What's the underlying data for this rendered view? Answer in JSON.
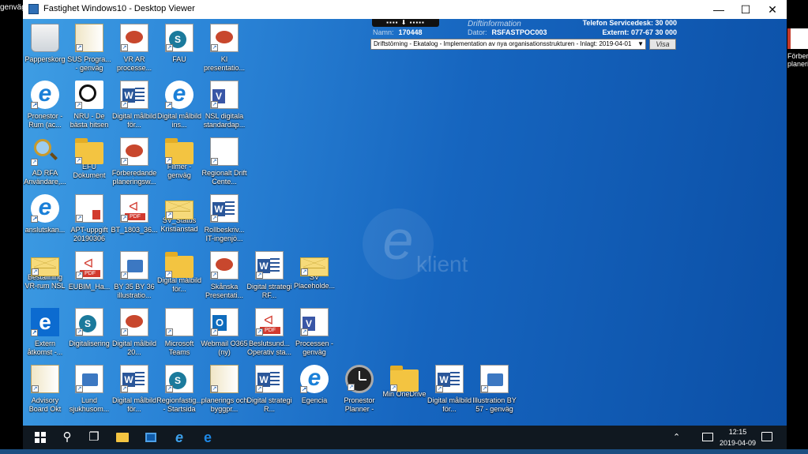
{
  "host": {
    "left_fragment": "genväg",
    "right_icon_label": "Förbereda planerin"
  },
  "window": {
    "title": "Fastighet Windows10 - Desktop Viewer",
    "controls": {
      "minimize": "—",
      "maximize": "☐",
      "close": "✕"
    }
  },
  "driftinfo": {
    "tab_label": "▪▪▪▪ ⬇ ▪▪▪▪▪",
    "title": "Driftinformation",
    "name_label": "Namn:",
    "name_value": "170448",
    "computer_label": "Dator:",
    "computer_value": "RSFASTPOC003",
    "servicedesk": "Telefon Servicedesk: 30 000",
    "external": "Externt: 077-67 30 000",
    "select_value": "Driftstörning - Ekatalog - Implementation av nya organisationsstrukturen - Inlagt: 2019-04-01",
    "button_label": "Visa"
  },
  "watermark": {
    "letter": "e",
    "text": "klient"
  },
  "icons": [
    {
      "label": "Papperskorg"
    },
    {
      "label": "SUS Progra... - genväg"
    },
    {
      "label": "VR AR processe..."
    },
    {
      "label": "FAU"
    },
    {
      "label": "KI presentatio..."
    },
    {
      "label": "Pronestor - Rum (ac..."
    },
    {
      "label": "NRU - De bästa hitsen"
    },
    {
      "label": "Digital målbild för..."
    },
    {
      "label": "Digital målbild ins..."
    },
    {
      "label": "NSL digitala standardap..."
    },
    {
      "label": "AD RFA Användare,..."
    },
    {
      "label": "EFU Dokument"
    },
    {
      "label": "Förberedande planeringsw..."
    },
    {
      "label": "Filmer - genväg"
    },
    {
      "label": "Regionalt Drift Cente..."
    },
    {
      "label": "anslutskan..."
    },
    {
      "label": "APT-uppgift 20190306"
    },
    {
      "label": "BT_1803_36..."
    },
    {
      "label": "SV_Status Kristianstad"
    },
    {
      "label": "Rollbeskriv... IT-ingenjö..."
    },
    {
      "label": "Beställning VR-rum NSL"
    },
    {
      "label": "EUBIM_Ha..."
    },
    {
      "label": "BY 35 BY 36 illustratio..."
    },
    {
      "label": "Digital målbild för..."
    },
    {
      "label": "Skånska Presentati..."
    },
    {
      "label": "Digital strategi RF..."
    },
    {
      "label": "SV Placeholde..."
    },
    {
      "label": "Extern åtkomst -..."
    },
    {
      "label": "Digitalisering"
    },
    {
      "label": "Digital målbild 20..."
    },
    {
      "label": "Microsoft Teams"
    },
    {
      "label": "Webmail O365 (ny)"
    },
    {
      "label": "Beslutsund... Operativ sta..."
    },
    {
      "label": "Processen - genväg"
    },
    {
      "label": "Advisory Board Okt"
    },
    {
      "label": "Lund sjukhusom..."
    },
    {
      "label": "Digital målbild för..."
    },
    {
      "label": "Regionfastig... - Startsida"
    },
    {
      "label": "planerings och byggpr..."
    },
    {
      "label": "Digital strategi R..."
    },
    {
      "label": "Egencia"
    },
    {
      "label": "Pronestor Planner -"
    },
    {
      "label": "Min OneDrive"
    },
    {
      "label": "Digital målbild för..."
    },
    {
      "label": "Illustration BY 57 - genväg"
    }
  ],
  "taskbar": {
    "clock_time": "12:15",
    "clock_date": "2019-04-09",
    "tray_arrow": "⌃"
  }
}
